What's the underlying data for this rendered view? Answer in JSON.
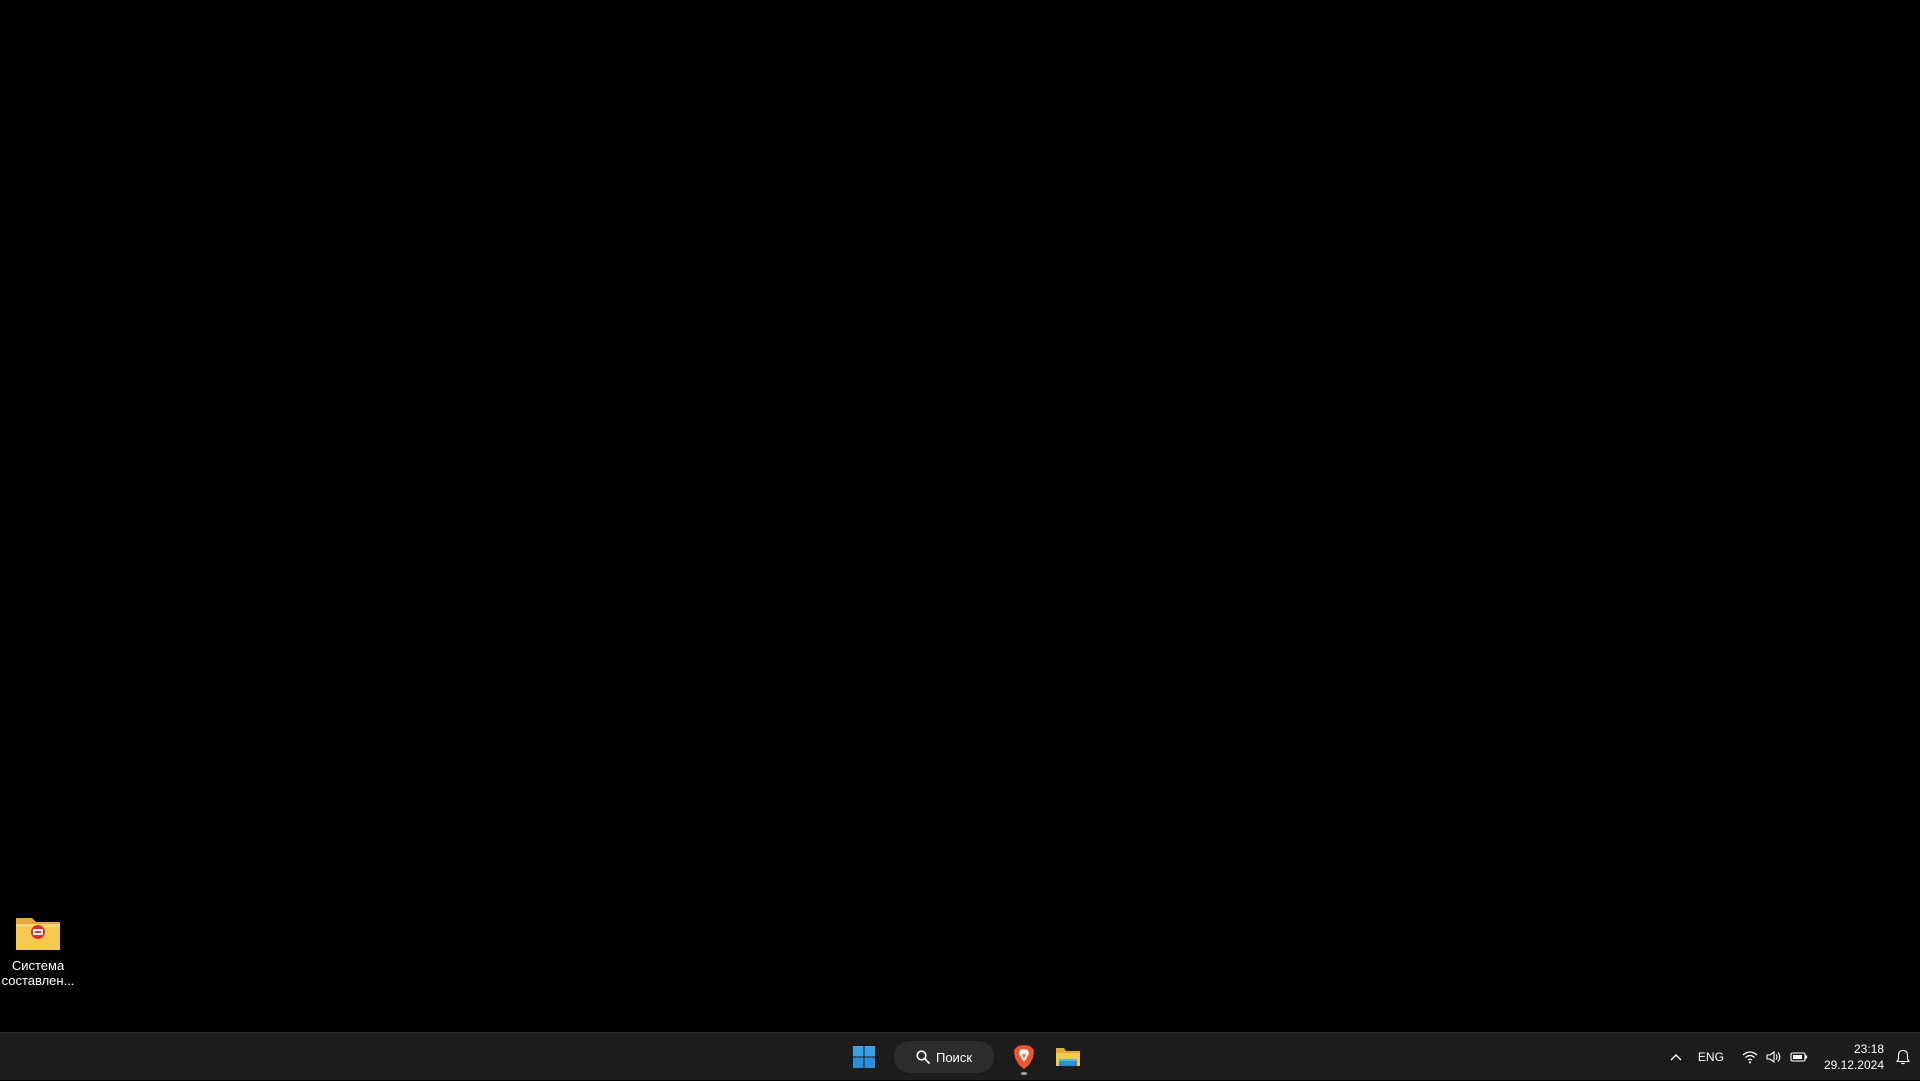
{
  "desktop": {
    "icons": [
      {
        "label_line1": "Система",
        "label_line2": "составлен...",
        "icon": "folder-with-badge-icon"
      }
    ]
  },
  "taskbar": {
    "start": {
      "icon": "windows-start-icon"
    },
    "search": {
      "label": "Поиск",
      "icon": "search-icon"
    },
    "apps": [
      {
        "name": "Brave",
        "icon": "brave-browser-icon",
        "running": true
      },
      {
        "name": "File Explorer",
        "icon": "file-explorer-icon",
        "running": false
      }
    ],
    "tray": {
      "overflow_icon": "chevron-up-icon",
      "language": "ENG",
      "icons": [
        "wifi-icon",
        "volume-icon",
        "battery-icon"
      ],
      "time": "23:18",
      "date": "29.12.2024",
      "notification_icon": "bell-icon"
    }
  },
  "colors": {
    "desktop_bg": "#000000",
    "taskbar_bg": "#1c1c1c",
    "search_bg": "#2d2d2d",
    "folder_yellow": "#f4c542",
    "badge_red": "#d9312b",
    "windows_blue": "#3aa0e8"
  }
}
